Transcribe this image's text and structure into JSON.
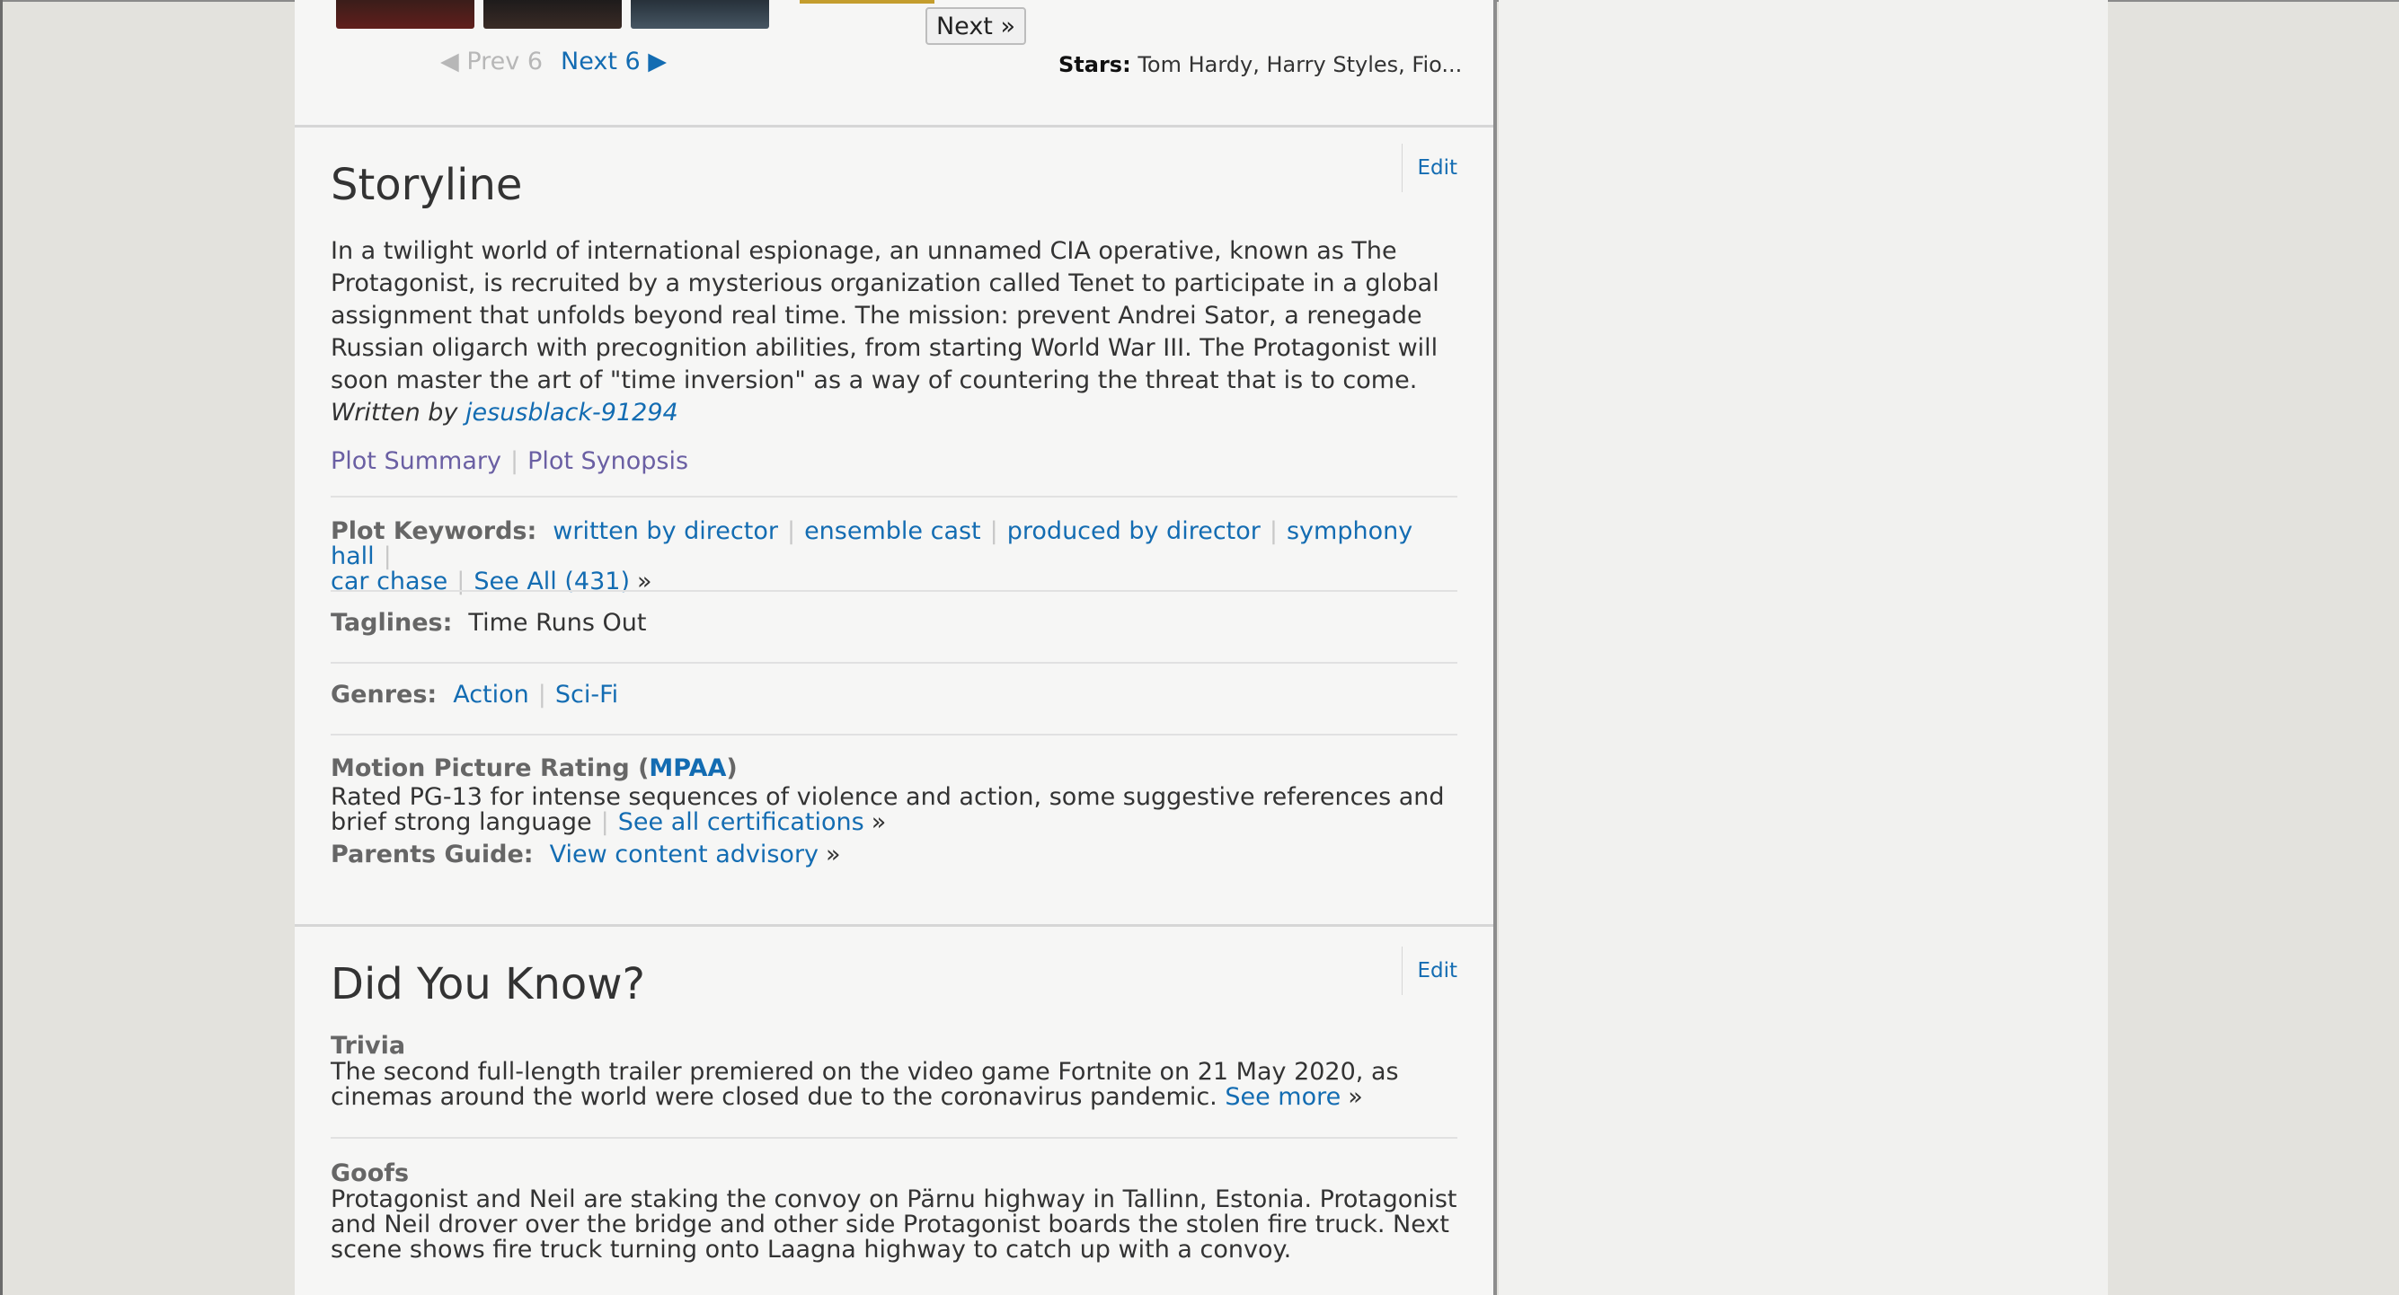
{
  "filmstrip": {
    "next_label": "Next »",
    "prev6_label": "◀ Prev 6",
    "next6_label": "Next 6 ▶"
  },
  "stars": {
    "label": "Stars:",
    "value": "Tom Hardy, Harry Styles, Fio..."
  },
  "storyline": {
    "title": "Storyline",
    "edit_label": "Edit",
    "text": "In a twilight world of international espionage, an unnamed CIA operative, known as The Protagonist, is recruited by a mysterious organization called Tenet to participate in a global assignment that unfolds beyond real time. The mission: prevent Andrei Sator, a renegade Russian oligarch with precognition abilities, from starting World War III. The Protagonist will soon master the art of \"time inversion\" as a way of countering the threat that is to come.",
    "written_by_label": "Written by",
    "author": "jesusblack-91294",
    "plot_summary_label": "Plot Summary",
    "plot_synopsis_label": "Plot Synopsis",
    "keywords_label": "Plot Keywords:",
    "keywords": [
      "written by director",
      "ensemble cast",
      "produced by director",
      "symphony hall",
      "car chase"
    ],
    "see_all_keywords": "See All (431)",
    "taglines_label": "Taglines:",
    "tagline": "Time Runs Out",
    "genres_label": "Genres:",
    "genres": [
      "Action",
      "Sci-Fi"
    ],
    "rating_label_prefix": "Motion Picture Rating (",
    "rating_org": "MPAA",
    "rating_label_suffix": ")",
    "rating_text": "Rated PG-13 for intense sequences of violence and action, some suggestive references and brief strong language",
    "see_all_certifications": "See all certifications",
    "parents_guide_label": "Parents Guide:",
    "parents_guide_link": "View content advisory"
  },
  "did_you_know": {
    "title": "Did You Know?",
    "edit_label": "Edit",
    "trivia_label": "Trivia",
    "trivia_text": "The second full-length trailer premiered on the video game Fortnite on 21 May 2020, as cinemas around the world were closed due to the coronavirus pandemic.",
    "see_more": "See more",
    "goofs_label": "Goofs",
    "goofs_text": "Protagonist and Neil are staking the convoy on Pärnu highway in Tallinn, Estonia. Protagonist and Neil drover over the bridge and other side Protagonist boards the stolen fire truck. Next scene shows fire truck turning onto Laagna highway to catch up with a convoy."
  },
  "colors": {
    "link": "#136cb2",
    "visited_link": "#6a5fa3",
    "page_bg": "#e3e2dd",
    "content_bg": "#f6f6f5"
  }
}
